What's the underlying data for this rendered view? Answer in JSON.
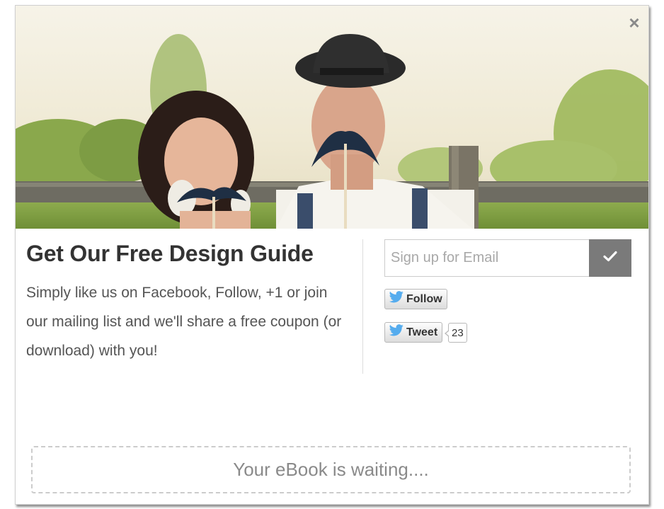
{
  "modal": {
    "close_label": "×",
    "title": "Get Our Free Design Guide",
    "description": "Simply like us on Facebook, Follow, +1 or join our mailing list and we'll share a free coupon (or download) with you!"
  },
  "signup": {
    "email_placeholder": "Sign up for Email",
    "email_value": "",
    "submit_icon": "checkmark-icon"
  },
  "social": {
    "follow_label": "Follow",
    "tweet_label": "Tweet",
    "tweet_count": "23",
    "icon": "twitter-bird-icon"
  },
  "ebook": {
    "label": "Your eBook is waiting...."
  },
  "hero": {
    "image": "couple-with-mustache-props-photo"
  },
  "colors": {
    "title": "#333333",
    "text": "#555555",
    "submit_bg": "#7a7a7a",
    "twitter_blue": "#55acee",
    "dashed_border": "#cccccc"
  }
}
